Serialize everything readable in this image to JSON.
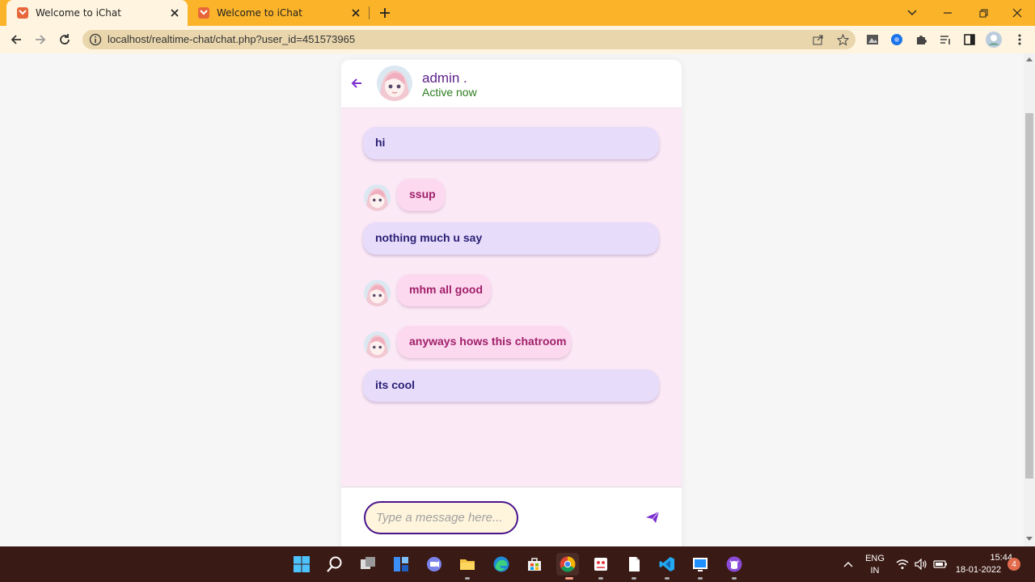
{
  "browser": {
    "tabs": [
      {
        "label": "Welcome to iChat",
        "active": true
      },
      {
        "label": "Welcome to iChat",
        "active": false
      }
    ],
    "url": "localhost/realtime-chat/chat.php?user_id=451573965",
    "accent_color": "#fbb42a"
  },
  "chat": {
    "header": {
      "name": "admin .",
      "status": "Active now"
    },
    "messages": [
      {
        "direction": "outgoing",
        "text": "hi"
      },
      {
        "direction": "incoming",
        "text": "ssup"
      },
      {
        "direction": "outgoing",
        "text": "nothing much u say"
      },
      {
        "direction": "incoming",
        "text": "mhm all good"
      },
      {
        "direction": "incoming",
        "text": "anyways hows this chatroom"
      },
      {
        "direction": "outgoing",
        "text": "its cool"
      }
    ],
    "input": {
      "placeholder": "Type a message here...",
      "value": ""
    },
    "colors": {
      "outgoing_bubble": "#e8dcfb",
      "incoming_bubble": "#fcd9ef",
      "chat_background": "#fbe9f6",
      "input_border": "#4a148c"
    }
  },
  "taskbar": {
    "lang_primary": "ENG",
    "lang_secondary": "IN",
    "time": "15:44",
    "date": "18-01-2022",
    "notification_count": "4"
  }
}
